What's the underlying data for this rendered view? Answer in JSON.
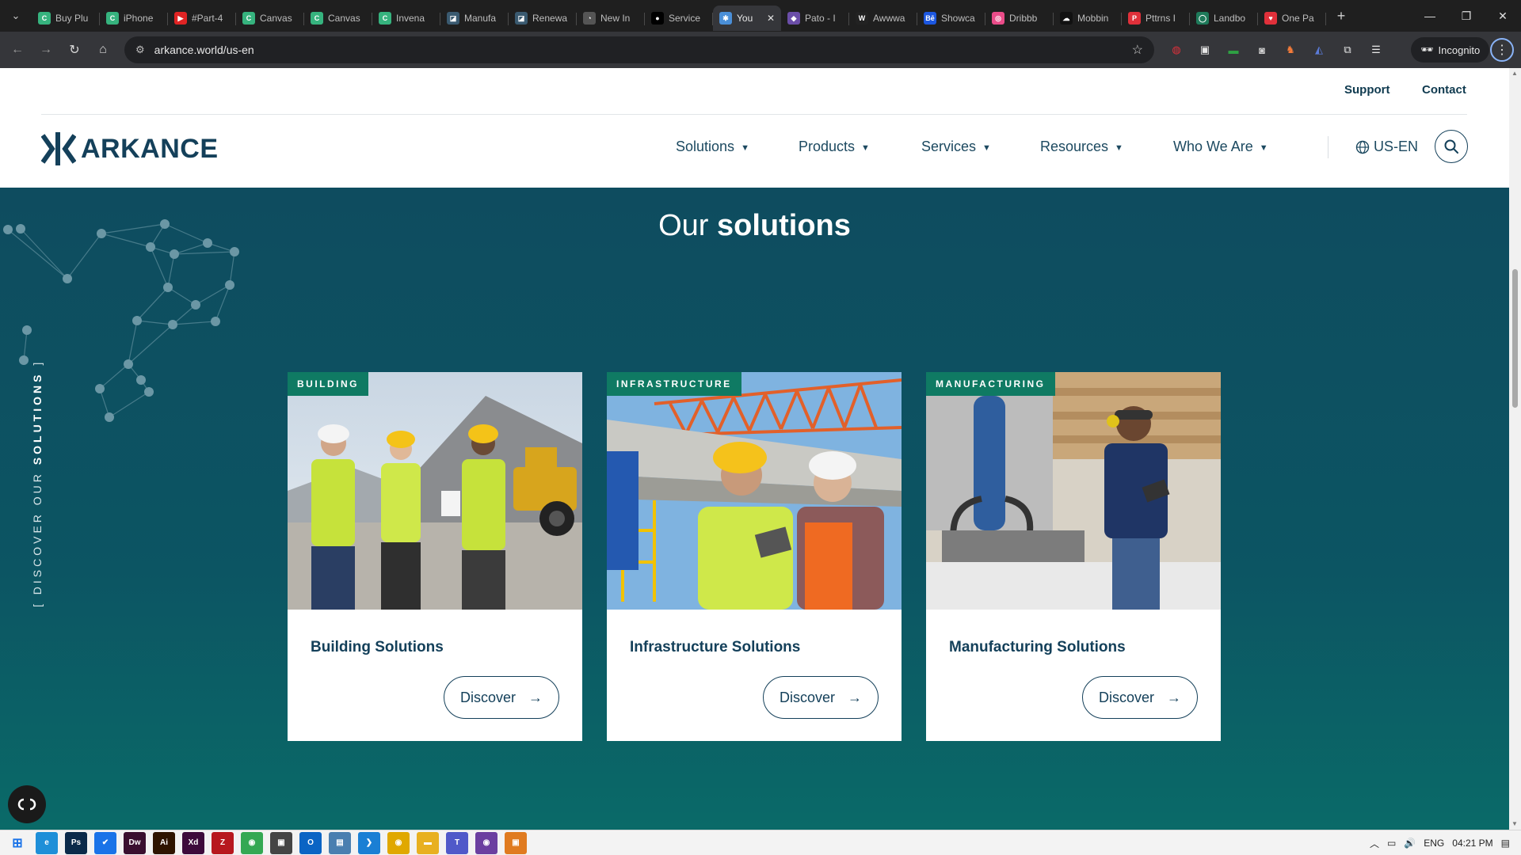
{
  "browser": {
    "tabs": [
      {
        "title": "Buy Plu",
        "fav_color": "#36b37e",
        "fav_glyph": "C"
      },
      {
        "title": "iPhone",
        "fav_color": "#36b37e",
        "fav_glyph": "C"
      },
      {
        "title": "#Part-4",
        "fav_color": "#e02424",
        "fav_glyph": "▶"
      },
      {
        "title": "Canvas",
        "fav_color": "#36b37e",
        "fav_glyph": "C"
      },
      {
        "title": "Canvas",
        "fav_color": "#36b37e",
        "fav_glyph": "C"
      },
      {
        "title": "Invena",
        "fav_color": "#36b37e",
        "fav_glyph": "C"
      },
      {
        "title": "Manufa",
        "fav_color": "#3a5a70",
        "fav_glyph": "◪"
      },
      {
        "title": "Renewa",
        "fav_color": "#3a5a70",
        "fav_glyph": "◪"
      },
      {
        "title": "New In",
        "fav_color": "#555555",
        "fav_glyph": "◔"
      },
      {
        "title": "Service",
        "fav_color": "#000000",
        "fav_glyph": "●"
      },
      {
        "title": "You",
        "fav_color": "#4a8fd8",
        "fav_glyph": "✱",
        "active": true
      },
      {
        "title": "Pato - I",
        "fav_color": "#6b4ea8",
        "fav_glyph": "◆"
      },
      {
        "title": "Awwwa",
        "fav_color": "#222222",
        "fav_glyph": "W"
      },
      {
        "title": "Showca",
        "fav_color": "#1c57e0",
        "fav_glyph": "Bē"
      },
      {
        "title": "Dribbb",
        "fav_color": "#ea4c89",
        "fav_glyph": "◎"
      },
      {
        "title": "Mobbin",
        "fav_color": "#111111",
        "fav_glyph": "☁"
      },
      {
        "title": "Pttrns I",
        "fav_color": "#e0303a",
        "fav_glyph": "P"
      },
      {
        "title": "Landbo",
        "fav_color": "#1e7a5a",
        "fav_glyph": "◯"
      },
      {
        "title": "One Pa",
        "fav_color": "#e0303a",
        "fav_glyph": "♥"
      }
    ],
    "url": "arkance.world/us-en",
    "incognito_label": "Incognito"
  },
  "site": {
    "top_links": {
      "support": "Support",
      "contact": "Contact"
    },
    "logo_text": "ARKANCE",
    "nav": [
      "Solutions",
      "Products",
      "Services",
      "Resources",
      "Who We Are"
    ],
    "language": "US-EN",
    "section_title_light": "Our",
    "section_title_bold": "solutions",
    "side_label_prefix": "[ DISCOVER OUR",
    "side_label_bold": "SOLUTIONS",
    "side_label_suffix": "]",
    "cards": [
      {
        "tag": "BUILDING",
        "title": "Building Solutions",
        "cta": "Discover"
      },
      {
        "tag": "INFRASTRUCTURE",
        "title": "Infrastructure Solutions",
        "cta": "Discover"
      },
      {
        "tag": "MANUFACTURING",
        "title": "Manufacturing Solutions",
        "cta": "Discover"
      }
    ],
    "colors": {
      "brand_dark": "#14405a",
      "tag_green": "#0f7a63",
      "hero_teal": "#0e4c5f"
    }
  },
  "taskbar": {
    "apps": [
      {
        "name": "edge",
        "glyph": "e",
        "color": "#1e8fd8"
      },
      {
        "name": "photoshop",
        "glyph": "Ps",
        "color": "#0b2a4a"
      },
      {
        "name": "check",
        "glyph": "✔",
        "color": "#1a73e8"
      },
      {
        "name": "dreamweaver",
        "glyph": "Dw",
        "color": "#3a0f2f"
      },
      {
        "name": "illustrator",
        "glyph": "Ai",
        "color": "#2f1400"
      },
      {
        "name": "xd",
        "glyph": "Xd",
        "color": "#3d0a3b"
      },
      {
        "name": "filezilla",
        "glyph": "Z",
        "color": "#b7181e"
      },
      {
        "name": "chrome",
        "glyph": "◉",
        "color": "#34a853"
      },
      {
        "name": "app",
        "glyph": "▣",
        "color": "#444"
      },
      {
        "name": "outlook",
        "glyph": "O",
        "color": "#0a64c4"
      },
      {
        "name": "notepad",
        "glyph": "▤",
        "color": "#4a7fb0"
      },
      {
        "name": "vscode",
        "glyph": "❯",
        "color": "#1a7fd4"
      },
      {
        "name": "chrome-2",
        "glyph": "◉",
        "color": "#e0a800"
      },
      {
        "name": "files",
        "glyph": "▬",
        "color": "#e8b020"
      },
      {
        "name": "teams",
        "glyph": "T",
        "color": "#5059c9"
      },
      {
        "name": "app-2",
        "glyph": "◉",
        "color": "#6b3fa0"
      },
      {
        "name": "app-3",
        "glyph": "▣",
        "color": "#e07b20"
      }
    ],
    "language": "ENG",
    "time": "04:21 PM"
  }
}
